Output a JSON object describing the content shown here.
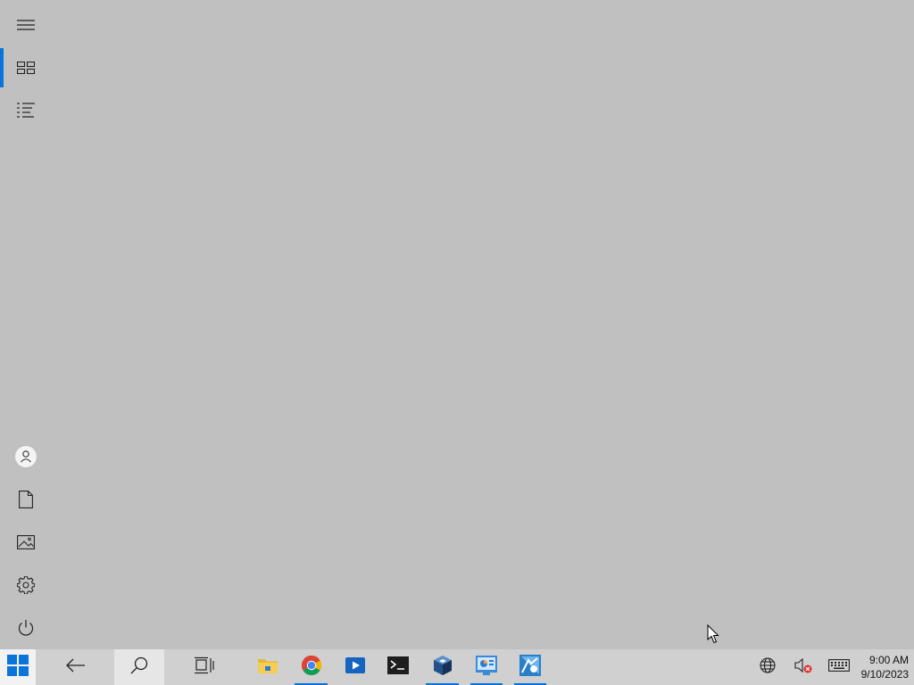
{
  "start_menu": {
    "rail_top": [
      {
        "name": "expand-menu-button",
        "icon": "hamburger-icon"
      },
      {
        "name": "pinned-tiles-button",
        "icon": "tiles-icon",
        "active": true
      },
      {
        "name": "all-apps-button",
        "icon": "list-icon"
      }
    ],
    "rail_bottom": [
      {
        "name": "user-account-button",
        "icon": "user-icon"
      },
      {
        "name": "documents-button",
        "icon": "document-icon"
      },
      {
        "name": "pictures-button",
        "icon": "pictures-icon"
      },
      {
        "name": "settings-button",
        "icon": "gear-icon"
      },
      {
        "name": "power-button",
        "icon": "power-icon"
      }
    ]
  },
  "taskbar": {
    "buttons": [
      {
        "name": "start-button",
        "icon": "windows-logo-icon"
      },
      {
        "name": "back-button",
        "icon": "back-arrow-icon"
      },
      {
        "name": "search-button",
        "icon": "search-icon"
      },
      {
        "name": "task-view-button",
        "icon": "task-view-icon"
      },
      {
        "name": "file-explorer-button",
        "icon": "folder-icon"
      },
      {
        "name": "chrome-button",
        "icon": "chrome-icon",
        "running": true
      },
      {
        "name": "media-player-button",
        "icon": "media-player-icon"
      },
      {
        "name": "terminal-button",
        "icon": "terminal-icon"
      },
      {
        "name": "virtualbox-button",
        "icon": "virtualbox-icon",
        "running": true
      },
      {
        "name": "control-panel-button",
        "icon": "control-panel-icon",
        "running": true
      },
      {
        "name": "app-button",
        "icon": "app-icon",
        "running": true
      }
    ],
    "tray": [
      {
        "name": "network-button",
        "icon": "globe-icon"
      },
      {
        "name": "volume-button",
        "icon": "volume-muted-icon"
      },
      {
        "name": "touch-keyboard-button",
        "icon": "keyboard-icon"
      }
    ],
    "clock": {
      "time": "9:00 AM",
      "date": "9/10/2023"
    }
  },
  "colors": {
    "desktop": "#c0c0c0",
    "taskbar": "#d0d0d0",
    "accent": "#0a74d9"
  }
}
